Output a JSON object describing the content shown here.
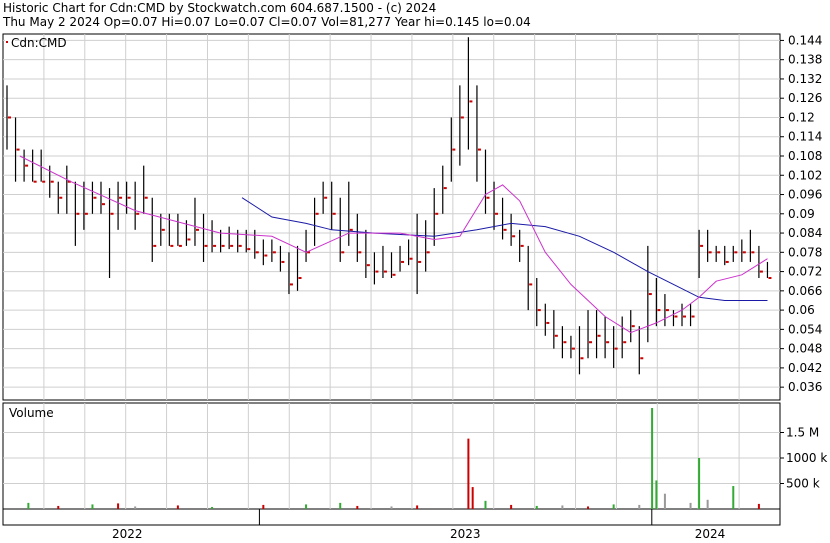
{
  "header": {
    "line1": "Historic Chart for Cdn:CMD by Stockwatch.com 604.687.1500 - (c) 2024",
    "line2": "Thu May  2 2024  Op=0.07  Hi=0.07  Lo=0.07  Cl=0.07  Vol=81,277  Year hi=0.145  lo=0.04"
  },
  "colors": {
    "price_bar": "#000000",
    "close_tick": "#cc0000",
    "ma_short": "#cc33cc",
    "ma_long": "#1a1aa6",
    "vol_up": "#33aa33",
    "vol_down": "#cc0000",
    "vol_flat": "#999999",
    "grid": "#cfcfcf"
  },
  "chart_data": [
    {
      "type": "line",
      "series_label": "Cdn:CMD",
      "grid": true,
      "ylim": [
        0.032,
        0.146
      ],
      "yticks": [
        "0.036",
        "0.042",
        "0.048",
        "0.054",
        "0.06",
        "0.066",
        "0.072",
        "0.078",
        "0.084",
        "0.09",
        "0.096",
        "0.102",
        "0.108",
        "0.114",
        "0.12",
        "0.126",
        "0.132",
        "0.138",
        "0.144"
      ],
      "xticks": [
        "2022",
        "2023",
        "2024"
      ],
      "bars": [
        [
          0,
          0.13,
          0.11,
          0.12
        ],
        [
          2,
          0.12,
          0.1,
          0.11
        ],
        [
          4,
          0.11,
          0.1,
          0.105
        ],
        [
          6,
          0.11,
          0.1,
          0.1
        ],
        [
          8,
          0.11,
          0.1,
          0.1
        ],
        [
          10,
          0.105,
          0.095,
          0.1
        ],
        [
          12,
          0.1,
          0.09,
          0.095
        ],
        [
          14,
          0.105,
          0.09,
          0.1
        ],
        [
          16,
          0.1,
          0.08,
          0.09
        ],
        [
          18,
          0.1,
          0.085,
          0.09
        ],
        [
          20,
          0.1,
          0.09,
          0.095
        ],
        [
          22,
          0.1,
          0.09,
          0.093
        ],
        [
          24,
          0.098,
          0.07,
          0.09
        ],
        [
          26,
          0.1,
          0.085,
          0.095
        ],
        [
          28,
          0.1,
          0.09,
          0.095
        ],
        [
          30,
          0.1,
          0.085,
          0.09
        ],
        [
          32,
          0.105,
          0.09,
          0.095
        ],
        [
          34,
          0.095,
          0.075,
          0.08
        ],
        [
          36,
          0.09,
          0.08,
          0.085
        ],
        [
          38,
          0.09,
          0.08,
          0.08
        ],
        [
          40,
          0.09,
          0.08,
          0.08
        ],
        [
          42,
          0.088,
          0.08,
          0.082
        ],
        [
          44,
          0.095,
          0.08,
          0.085
        ],
        [
          46,
          0.09,
          0.075,
          0.08
        ],
        [
          48,
          0.088,
          0.078,
          0.08
        ],
        [
          50,
          0.085,
          0.078,
          0.08
        ],
        [
          52,
          0.086,
          0.079,
          0.08
        ],
        [
          54,
          0.085,
          0.078,
          0.08
        ],
        [
          56,
          0.085,
          0.078,
          0.079
        ],
        [
          58,
          0.085,
          0.076,
          0.078
        ],
        [
          60,
          0.082,
          0.074,
          0.077
        ],
        [
          62,
          0.082,
          0.075,
          0.078
        ],
        [
          64,
          0.08,
          0.072,
          0.075
        ],
        [
          66,
          0.078,
          0.065,
          0.068
        ],
        [
          68,
          0.08,
          0.066,
          0.07
        ],
        [
          70,
          0.085,
          0.075,
          0.078
        ],
        [
          72,
          0.095,
          0.08,
          0.09
        ],
        [
          74,
          0.1,
          0.09,
          0.095
        ],
        [
          76,
          0.1,
          0.085,
          0.09
        ],
        [
          78,
          0.095,
          0.075,
          0.078
        ],
        [
          80,
          0.1,
          0.08,
          0.085
        ],
        [
          82,
          0.09,
          0.075,
          0.078
        ],
        [
          84,
          0.085,
          0.07,
          0.074
        ],
        [
          86,
          0.078,
          0.068,
          0.072
        ],
        [
          88,
          0.08,
          0.07,
          0.072
        ],
        [
          90,
          0.078,
          0.07,
          0.071
        ],
        [
          92,
          0.08,
          0.072,
          0.075
        ],
        [
          94,
          0.082,
          0.074,
          0.076
        ],
        [
          96,
          0.09,
          0.065,
          0.075
        ],
        [
          98,
          0.088,
          0.072,
          0.078
        ],
        [
          100,
          0.098,
          0.08,
          0.09
        ],
        [
          102,
          0.105,
          0.09,
          0.098
        ],
        [
          104,
          0.12,
          0.1,
          0.11
        ],
        [
          106,
          0.13,
          0.105,
          0.12
        ],
        [
          108,
          0.145,
          0.11,
          0.125
        ],
        [
          110,
          0.13,
          0.1,
          0.11
        ],
        [
          112,
          0.11,
          0.09,
          0.095
        ],
        [
          114,
          0.1,
          0.085,
          0.09
        ],
        [
          116,
          0.095,
          0.082,
          0.085
        ],
        [
          118,
          0.09,
          0.08,
          0.083
        ],
        [
          120,
          0.085,
          0.075,
          0.08
        ],
        [
          122,
          0.08,
          0.06,
          0.068
        ],
        [
          124,
          0.07,
          0.055,
          0.06
        ],
        [
          126,
          0.062,
          0.052,
          0.056
        ],
        [
          128,
          0.06,
          0.048,
          0.052
        ],
        [
          130,
          0.055,
          0.045,
          0.05
        ],
        [
          132,
          0.052,
          0.045,
          0.048
        ],
        [
          134,
          0.055,
          0.04,
          0.045
        ],
        [
          136,
          0.06,
          0.045,
          0.05
        ],
        [
          138,
          0.06,
          0.045,
          0.052
        ],
        [
          140,
          0.058,
          0.045,
          0.05
        ],
        [
          142,
          0.055,
          0.042,
          0.048
        ],
        [
          144,
          0.058,
          0.045,
          0.05
        ],
        [
          146,
          0.06,
          0.05,
          0.055
        ],
        [
          148,
          0.055,
          0.04,
          0.045
        ],
        [
          150,
          0.08,
          0.05,
          0.065
        ],
        [
          152,
          0.07,
          0.055,
          0.06
        ],
        [
          154,
          0.065,
          0.055,
          0.06
        ],
        [
          156,
          0.06,
          0.055,
          0.058
        ],
        [
          158,
          0.062,
          0.055,
          0.058
        ],
        [
          160,
          0.062,
          0.055,
          0.058
        ],
        [
          162,
          0.085,
          0.07,
          0.08
        ],
        [
          164,
          0.085,
          0.075,
          0.078
        ],
        [
          166,
          0.08,
          0.075,
          0.078
        ],
        [
          168,
          0.08,
          0.074,
          0.075
        ],
        [
          170,
          0.08,
          0.075,
          0.078
        ],
        [
          172,
          0.082,
          0.075,
          0.078
        ],
        [
          174,
          0.085,
          0.075,
          0.078
        ],
        [
          176,
          0.08,
          0.07,
          0.072
        ],
        [
          178,
          0.075,
          0.07,
          0.07
        ]
      ],
      "ma_short": [
        [
          3,
          0.108
        ],
        [
          15,
          0.1
        ],
        [
          30,
          0.091
        ],
        [
          50,
          0.084
        ],
        [
          62,
          0.083
        ],
        [
          70,
          0.078
        ],
        [
          80,
          0.084
        ],
        [
          92,
          0.084
        ],
        [
          100,
          0.082
        ],
        [
          106,
          0.083
        ],
        [
          112,
          0.096
        ],
        [
          116,
          0.099
        ],
        [
          120,
          0.094
        ],
        [
          126,
          0.078
        ],
        [
          132,
          0.068
        ],
        [
          140,
          0.058
        ],
        [
          146,
          0.053
        ],
        [
          152,
          0.056
        ],
        [
          158,
          0.06
        ],
        [
          162,
          0.064
        ],
        [
          166,
          0.069
        ],
        [
          172,
          0.071
        ],
        [
          178,
          0.076
        ]
      ],
      "ma_long": [
        [
          55,
          0.095
        ],
        [
          62,
          0.089
        ],
        [
          70,
          0.087
        ],
        [
          76,
          0.085
        ],
        [
          86,
          0.084
        ],
        [
          100,
          0.083
        ],
        [
          110,
          0.085
        ],
        [
          118,
          0.087
        ],
        [
          126,
          0.086
        ],
        [
          134,
          0.083
        ],
        [
          142,
          0.078
        ],
        [
          150,
          0.072
        ],
        [
          156,
          0.068
        ],
        [
          162,
          0.064
        ],
        [
          168,
          0.063
        ],
        [
          178,
          0.063
        ]
      ]
    },
    {
      "type": "bar",
      "series_label": "Volume",
      "grid": true,
      "ylim": [
        0,
        2000000
      ],
      "yticks": [
        "500 k",
        "1000 k",
        "1.5 M"
      ],
      "xticks": [
        "2022",
        "2023",
        "2024"
      ],
      "values": [
        [
          5,
          120000,
          "up"
        ],
        [
          12,
          60000,
          "down"
        ],
        [
          20,
          90000,
          "up"
        ],
        [
          26,
          110000,
          "down"
        ],
        [
          30,
          50000,
          "flat"
        ],
        [
          40,
          70000,
          "down"
        ],
        [
          48,
          40000,
          "up"
        ],
        [
          60,
          80000,
          "down"
        ],
        [
          70,
          90000,
          "up"
        ],
        [
          78,
          120000,
          "up"
        ],
        [
          82,
          60000,
          "down"
        ],
        [
          90,
          50000,
          "flat"
        ],
        [
          96,
          70000,
          "down"
        ],
        [
          108,
          1380000,
          "down"
        ],
        [
          109,
          430000,
          "down"
        ],
        [
          112,
          160000,
          "up"
        ],
        [
          118,
          80000,
          "down"
        ],
        [
          124,
          60000,
          "up"
        ],
        [
          130,
          70000,
          "flat"
        ],
        [
          136,
          50000,
          "down"
        ],
        [
          142,
          90000,
          "up"
        ],
        [
          148,
          80000,
          "flat"
        ],
        [
          151,
          1980000,
          "up"
        ],
        [
          152,
          560000,
          "up"
        ],
        [
          154,
          300000,
          "flat"
        ],
        [
          160,
          120000,
          "flat"
        ],
        [
          162,
          1000000,
          "up"
        ],
        [
          164,
          180000,
          "flat"
        ],
        [
          170,
          450000,
          "up"
        ],
        [
          176,
          100000,
          "down"
        ]
      ]
    }
  ]
}
